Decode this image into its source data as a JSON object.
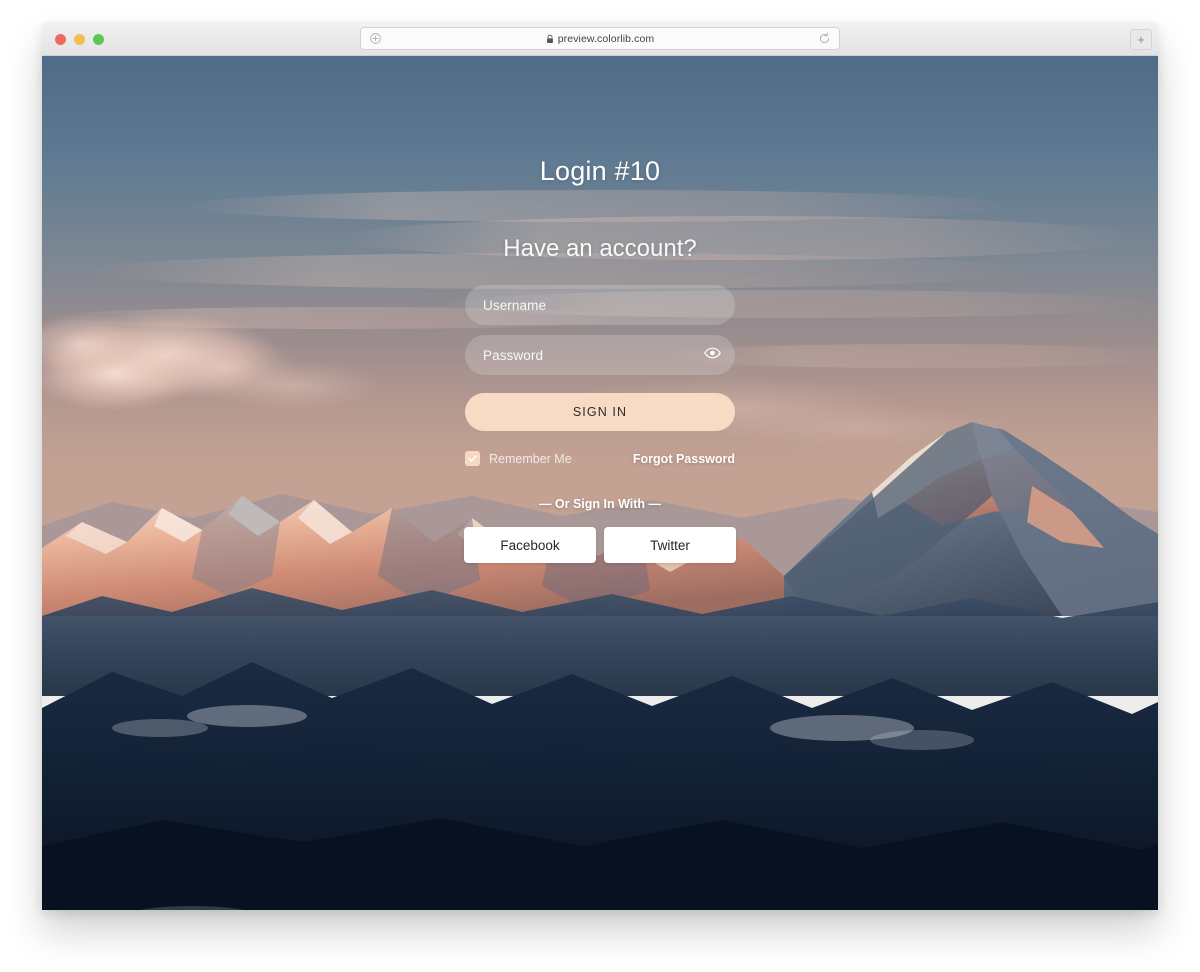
{
  "browser": {
    "url": "preview.colorlib.com",
    "lock_icon": "lock-icon",
    "site_info_icon": "site-info-icon",
    "reload_icon": "reload-icon",
    "new_tab_label": "+",
    "traffic_lights": [
      "close",
      "minimize",
      "maximize"
    ]
  },
  "page": {
    "title": "Login #10",
    "subtitle": "Have an account?",
    "form": {
      "username_placeholder": "Username",
      "username_value": "",
      "password_placeholder": "Password",
      "password_value": "",
      "password_toggle_icon": "eye-icon",
      "submit_label": "SIGN IN",
      "remember_label": "Remember Me",
      "remember_checked": true,
      "check_icon": "check-icon",
      "forgot_label": "Forgot Password"
    },
    "social": {
      "divider": "— Or Sign In With —",
      "buttons": [
        {
          "label": "Facebook"
        },
        {
          "label": "Twitter"
        }
      ]
    }
  },
  "colors": {
    "accent_peach": "#f8dbc5",
    "checkbox_peach": "#f6d9c4",
    "button_white": "#ffffff",
    "text_white": "#ffffff",
    "traffic_red": "#ec6a5f",
    "traffic_yellow": "#f4bd50",
    "traffic_green": "#61c555",
    "sky_top": "#5a7590",
    "sky_mid": "#8e8d93",
    "sky_warm": "#c6a394",
    "peak_glow": "#e8a88d",
    "shadow_navy": "#13243a",
    "foreground_dark": "#0d1826"
  }
}
